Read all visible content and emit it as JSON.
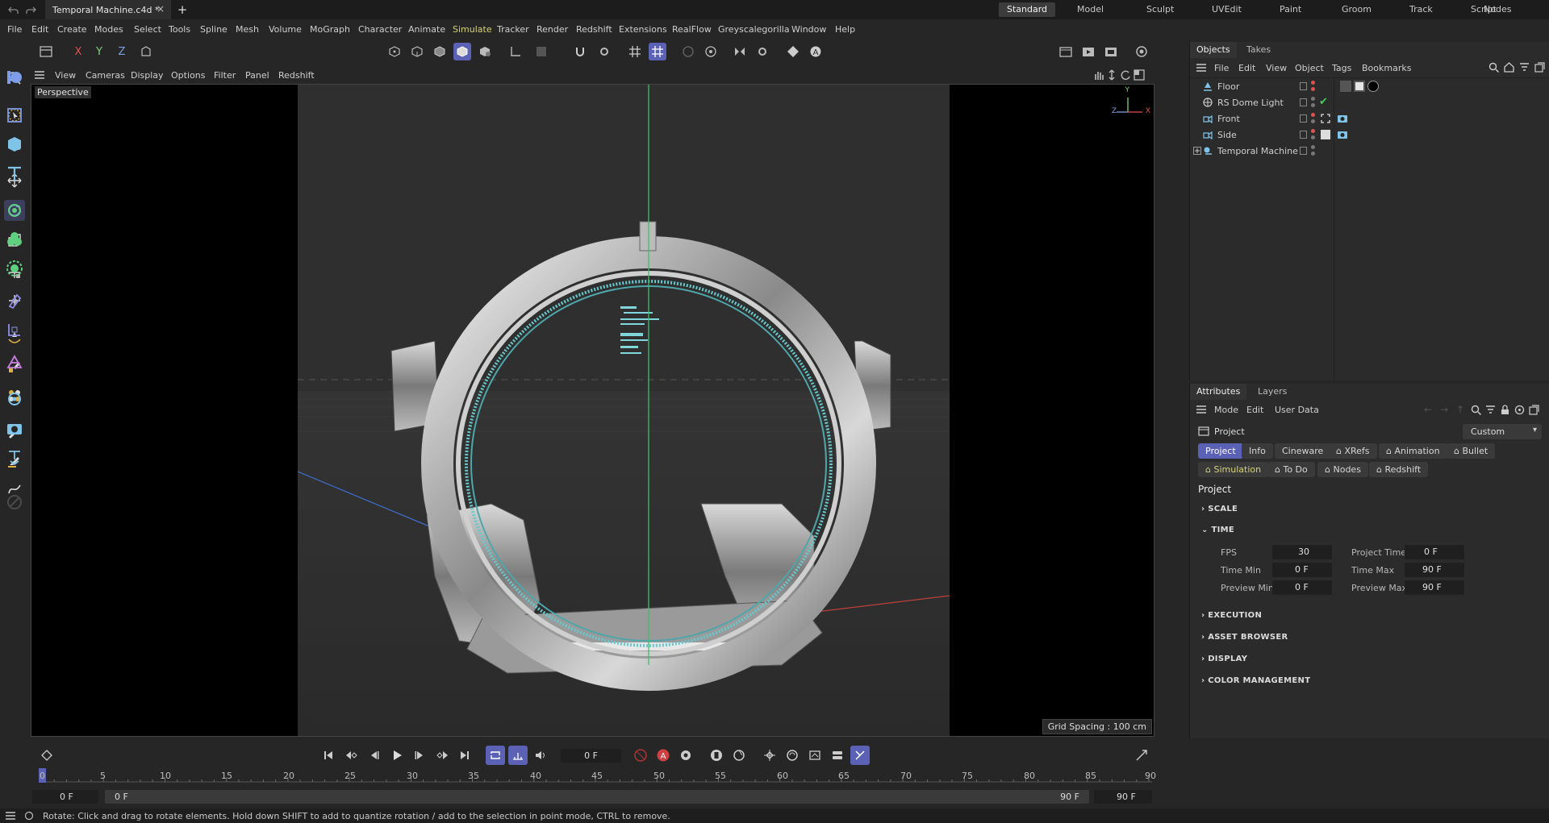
{
  "titlebar": {
    "doc_title": "Temporal Machine.c4d *",
    "layouts": [
      "Standard",
      "Model",
      "Sculpt",
      "UVEdit",
      "Paint",
      "Groom",
      "Track",
      "Script",
      "Nodes"
    ],
    "active_layout": "Standard"
  },
  "menu": [
    "File",
    "Edit",
    "Create",
    "Modes",
    "Select",
    "Tools",
    "Spline",
    "Mesh",
    "Volume",
    "MoGraph",
    "Character",
    "Animate",
    "Simulate",
    "Tracker",
    "Render",
    "Redshift",
    "Extensions",
    "RealFlow",
    "Greyscalegorilla",
    "Window",
    "Help"
  ],
  "axis_lock": {
    "x": "X",
    "y": "Y",
    "z": "Z"
  },
  "viewport": {
    "menu": [
      "View",
      "Cameras",
      "Display",
      "Options",
      "Filter",
      "Panel",
      "Redshift"
    ],
    "camera_label": "Perspective",
    "grid_spacing": "Grid Spacing : 100 cm",
    "axis_x": "X",
    "axis_y": "Y",
    "axis_z": "Z"
  },
  "objects_panel": {
    "tabs": [
      "Objects",
      "Takes"
    ],
    "menu": [
      "File",
      "Edit",
      "View",
      "Object",
      "Tags",
      "Bookmarks"
    ],
    "items": [
      {
        "name": "Floor"
      },
      {
        "name": "RS Dome Light"
      },
      {
        "name": "Front"
      },
      {
        "name": "Side"
      },
      {
        "name": "Temporal Machine"
      }
    ]
  },
  "attributes_panel": {
    "tabs": [
      "Attributes",
      "Layers"
    ],
    "menu": [
      "Mode",
      "Edit",
      "User Data"
    ],
    "context_label": "Project",
    "preset": "Custom",
    "chips_row1": [
      "Project",
      "Info",
      "Cineware",
      "XRefs",
      "Animation",
      "Bullet"
    ],
    "chips_row2": [
      "Simulation",
      "To Do",
      "Nodes",
      "Redshift"
    ],
    "heading": "Project",
    "sections": {
      "scale": "SCALE",
      "time": "TIME",
      "execution": "EXECUTION",
      "asset_browser": "ASSET BROWSER",
      "display": "DISPLAY",
      "color_management": "COLOR MANAGEMENT"
    },
    "time_fields": {
      "fps_label": "FPS",
      "fps": "30",
      "project_time_label": "Project Time",
      "project_time": "0 F",
      "time_min_label": "Time Min",
      "time_min": "0 F",
      "time_max_label": "Time Max",
      "time_max": "90 F",
      "preview_min_label": "Preview Min",
      "preview_min": "0 F",
      "preview_max_label": "Preview Max",
      "preview_max": "90 F"
    }
  },
  "timeline": {
    "current_frame": "0 F",
    "ruler": [
      "0",
      "5",
      "10",
      "15",
      "20",
      "25",
      "30",
      "35",
      "40",
      "45",
      "50",
      "55",
      "60",
      "65",
      "70",
      "75",
      "80",
      "85",
      "90"
    ],
    "range_start": "0 F",
    "range_inner_start": "0 F",
    "range_inner_end": "90 F",
    "range_end": "90 F"
  },
  "status": "Rotate: Click and drag to rotate elements. Hold down SHIFT to add to quantize rotation / add to the selection in point mode, CTRL to remove.",
  "colors": {
    "accent": "#5b62b5",
    "highlight_menu": "#d6d37a",
    "tag_red": "#e05050",
    "tag_green": "#3fcf5a"
  }
}
